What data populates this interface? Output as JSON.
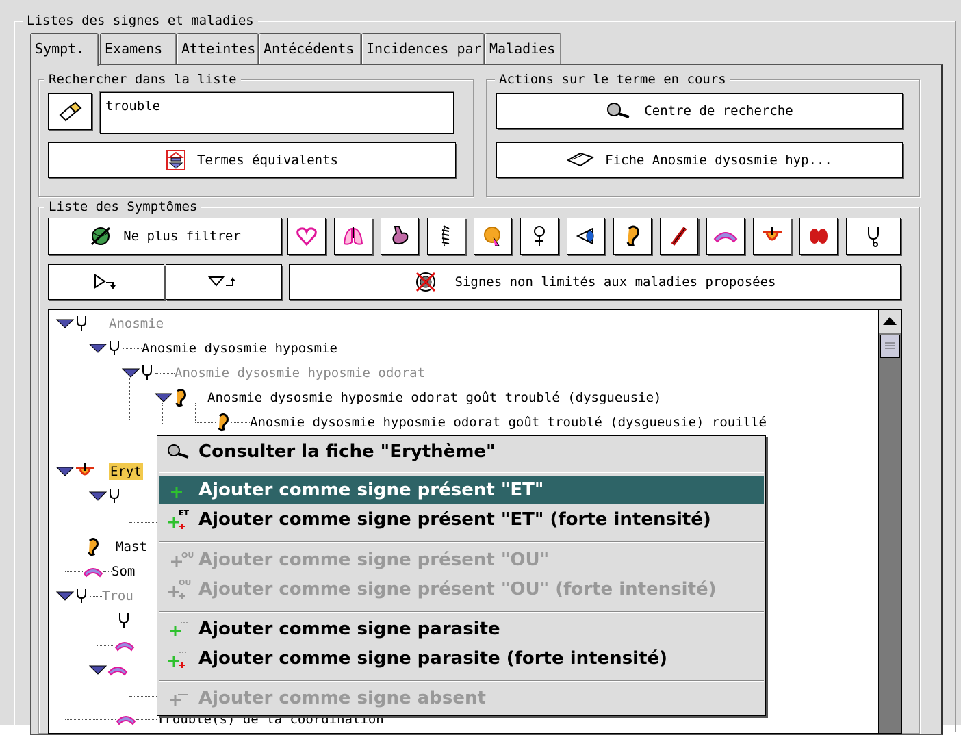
{
  "window_group": {
    "title": "Listes des signes et maladies"
  },
  "tabs": [
    "Sympt.",
    "Examens",
    "Atteintes",
    "Antécédents",
    "Incidences par.",
    "Maladies"
  ],
  "search": {
    "title": "Rechercher dans la liste",
    "value": "trouble",
    "equiv_button": "Termes équivalents"
  },
  "actions": {
    "title": "Actions sur le terme en cours",
    "center_button": "Centre de recherche",
    "fiche_button": "Fiche Anosmie dysosmie hyp..."
  },
  "symptoms": {
    "title": "Liste des Symptômes",
    "no_filter_button": "Ne plus filtrer",
    "filter_icons": [
      "heart-icon",
      "lungs-icon",
      "stomach-icon",
      "spine-icon",
      "brain-icon",
      "female-icon",
      "eye-icon",
      "ear-icon",
      "pen-icon",
      "nerve-icon",
      "skin-icon",
      "kidneys-icon",
      "stethoscope-icon"
    ],
    "non_limited_button": "Signes non limités aux maladies proposées"
  },
  "tree": [
    {
      "label": "Anosmie",
      "gray": true
    },
    {
      "label": "Anosmie dysosmie hyposmie",
      "gray": false
    },
    {
      "label": "Anosmie dysosmie hyposmie odorat",
      "gray": true
    },
    {
      "label": "Anosmie dysosmie hyposmie odorat goût troublé (dysgueusie)",
      "gray": false
    },
    {
      "label": "Anosmie dysosmie hyposmie odorat goût troublé (dysgueusie) rouillé",
      "gray": false
    },
    {
      "label": "Eryt",
      "gray": false
    },
    {
      "label": "Mast",
      "gray": false
    },
    {
      "label": "Som",
      "gray": false
    },
    {
      "label": "Trou",
      "gray": true
    },
    {
      "label": "Trouble(s) de la coordination",
      "gray": false
    }
  ],
  "context_menu": {
    "items": [
      {
        "label": "Consulter la fiche \"Erythème\"",
        "state": "normal"
      },
      {
        "label": "Ajouter comme signe présent \"ET\"",
        "state": "highlighted"
      },
      {
        "label": "Ajouter comme signe présent \"ET\" (forte intensité)",
        "state": "normal"
      },
      {
        "label": "Ajouter comme signe présent \"OU\"",
        "state": "disabled"
      },
      {
        "label": "Ajouter comme signe présent \"OU\" (forte intensité)",
        "state": "disabled"
      },
      {
        "label": "Ajouter comme signe parasite",
        "state": "normal"
      },
      {
        "label": "Ajouter comme signe parasite (forte intensité)",
        "state": "normal"
      },
      {
        "label": "Ajouter comme signe absent",
        "state": "disabled"
      }
    ],
    "icon_marks": [
      "ET",
      "OU",
      "OU"
    ]
  },
  "colors": {
    "panel": "#dddddd",
    "highlight": "#2e6467",
    "selection": "#f2c94c",
    "tree_arrow": "#4a4aa8"
  }
}
